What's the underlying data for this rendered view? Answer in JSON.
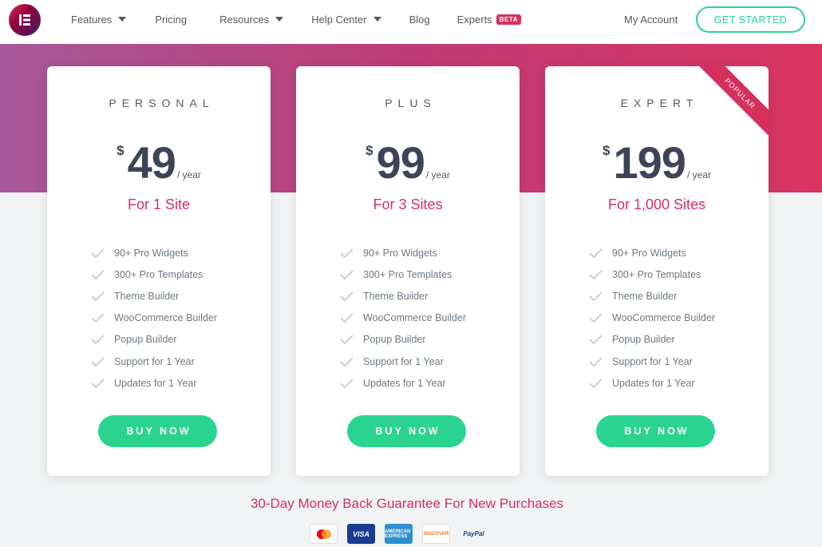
{
  "header": {
    "nav": [
      {
        "label": "Features",
        "dropdown": true
      },
      {
        "label": "Pricing",
        "dropdown": false
      },
      {
        "label": "Resources",
        "dropdown": true
      },
      {
        "label": "Help Center",
        "dropdown": true
      },
      {
        "label": "Blog",
        "dropdown": false
      },
      {
        "label": "Experts",
        "dropdown": false,
        "badge": "BETA"
      }
    ],
    "my_account": "My Account",
    "cta": "GET STARTED"
  },
  "plans": [
    {
      "name": "PERSONAL",
      "currency": "$",
      "amount": "49",
      "period": "/ year",
      "sites": "For 1 Site",
      "button": "BUY NOW"
    },
    {
      "name": "PLUS",
      "currency": "$",
      "amount": "99",
      "period": "/ year",
      "sites": "For 3 Sites",
      "button": "BUY NOW"
    },
    {
      "name": "EXPERT",
      "currency": "$",
      "amount": "199",
      "period": "/ year",
      "sites": "For 1,000 Sites",
      "button": "BUY NOW",
      "ribbon": "POPULAR"
    }
  ],
  "features": [
    "90+ Pro Widgets",
    "300+ Pro Templates",
    "Theme Builder",
    "WooCommerce Builder",
    "Popup Builder",
    "Support for 1 Year",
    "Updates for 1 Year"
  ],
  "guarantee": "30-Day Money Back Guarantee For New Purchases",
  "payments": {
    "visa": "VISA",
    "amex": "AMERICAN EXPRESS",
    "discover": "DISCOVER",
    "paypal": "PayPal"
  },
  "colors": {
    "accent": "#d6305d",
    "green": "#2bd390",
    "heading": "#3d4459"
  }
}
